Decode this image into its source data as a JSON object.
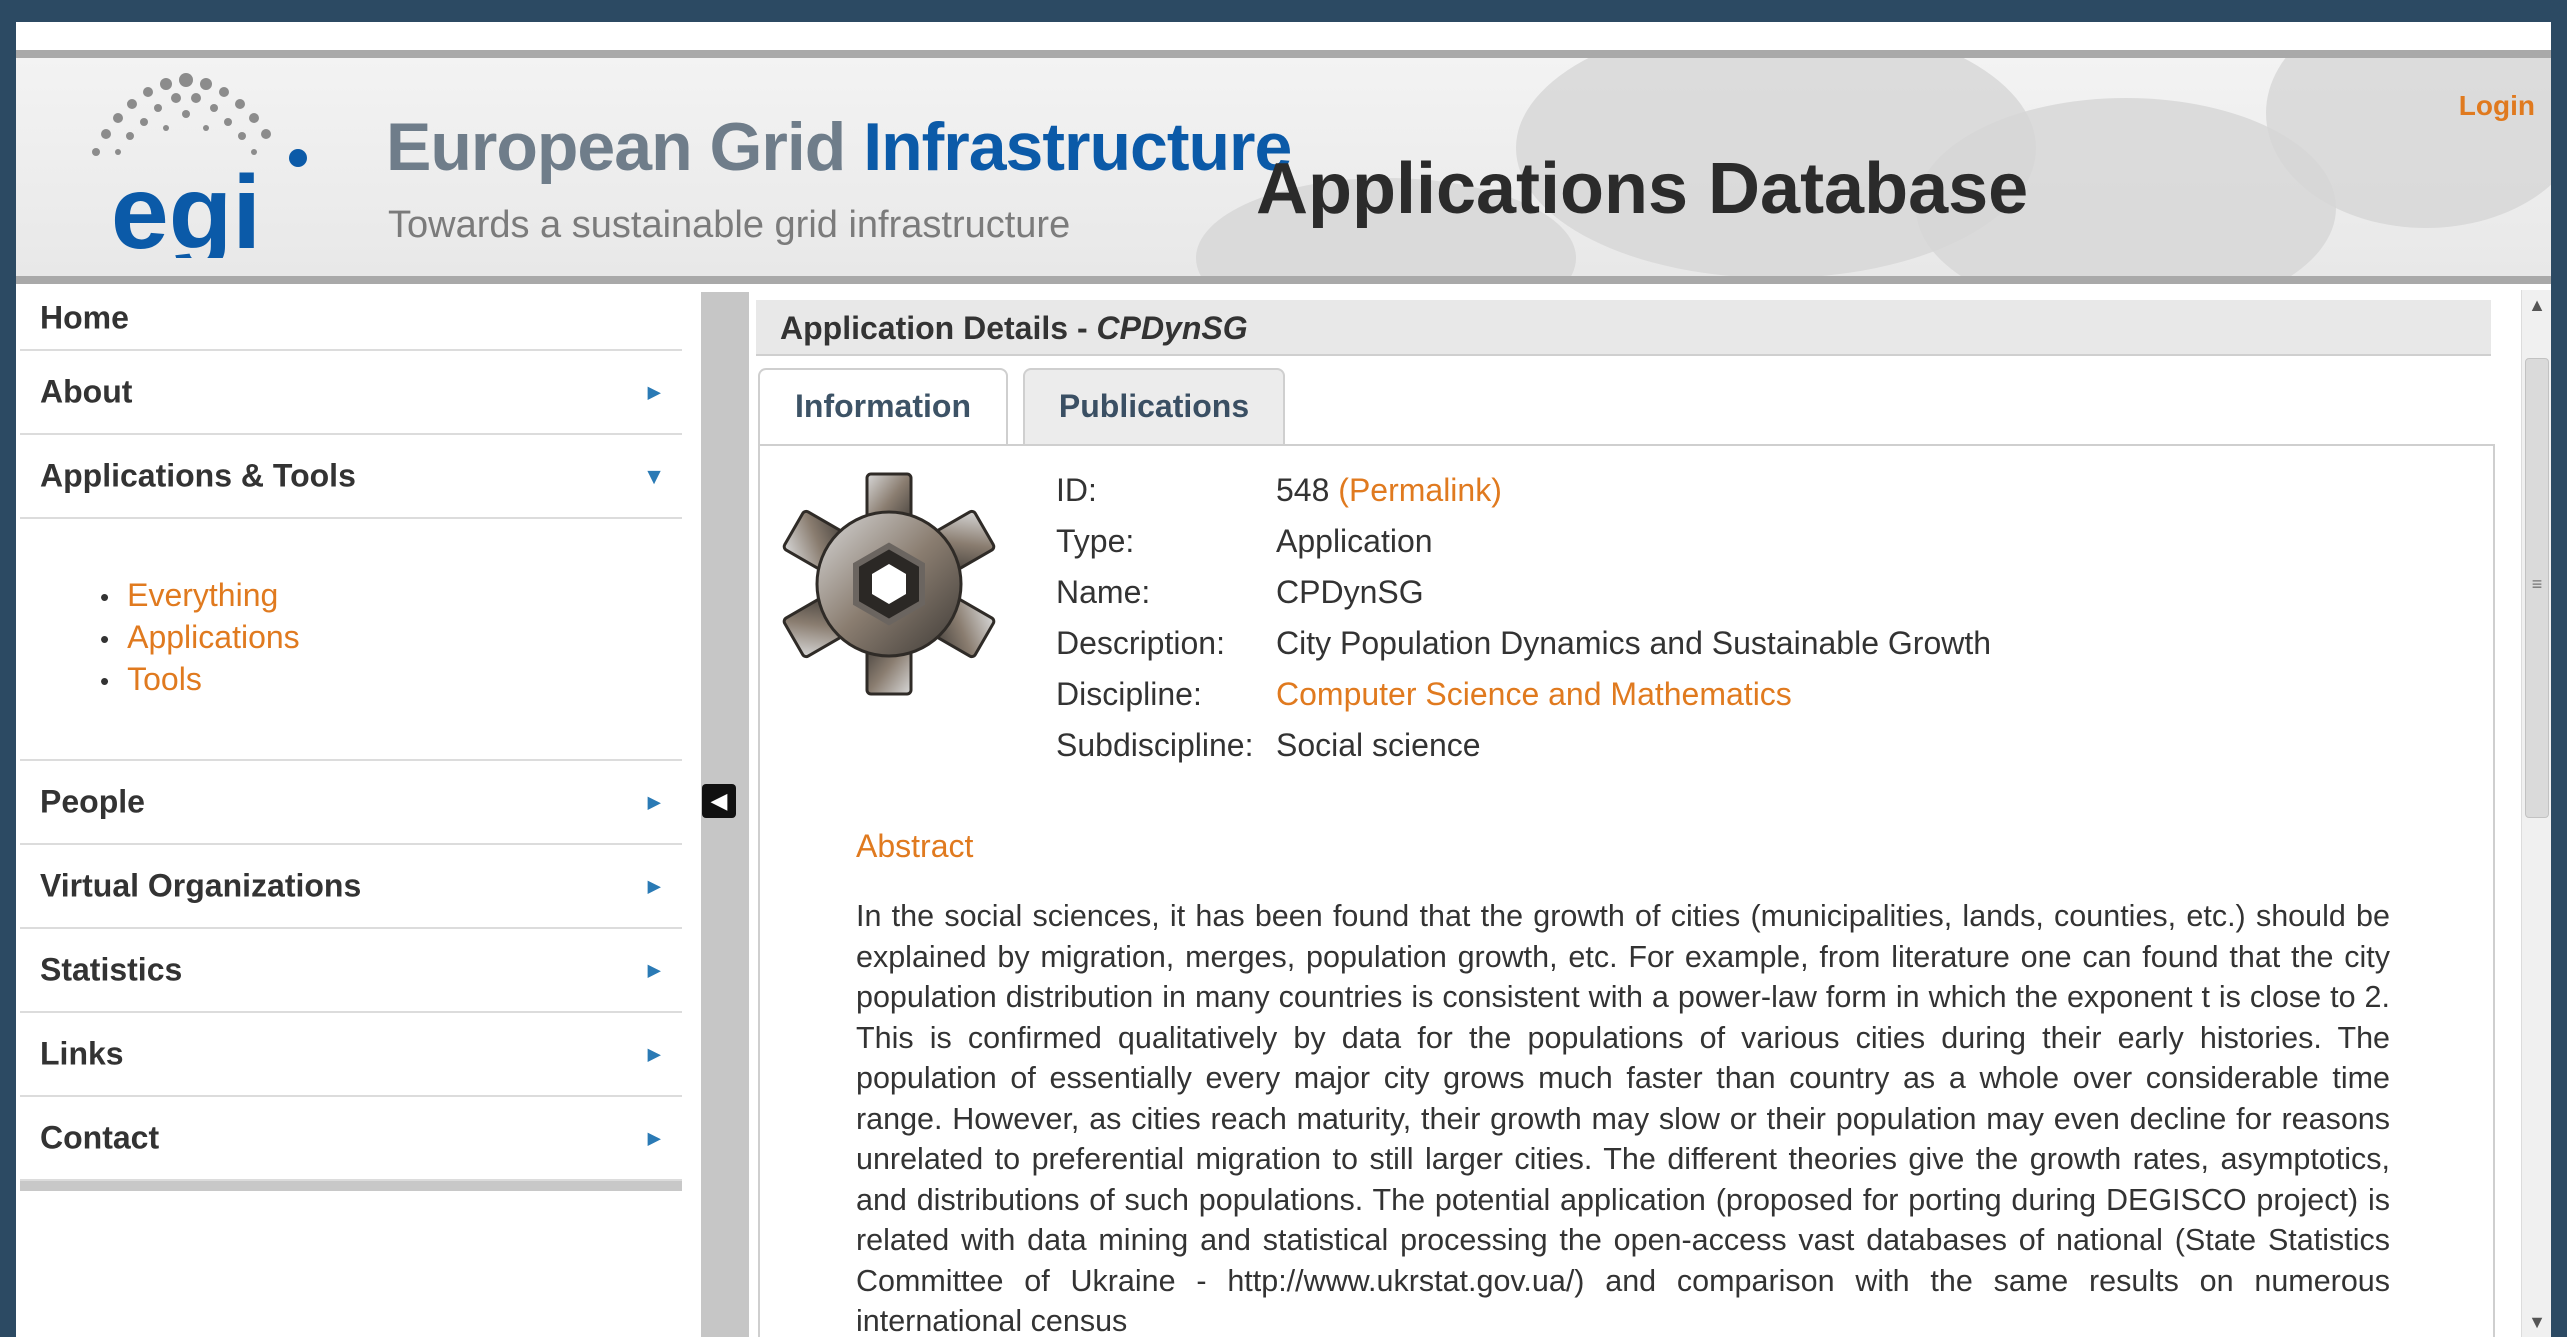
{
  "header": {
    "brand_part1": "European Grid ",
    "brand_part2": "Infrastructure",
    "tagline": "Towards a sustainable grid infrastructure",
    "app_title": "Applications Database",
    "login_label": "Login",
    "logo_text": "egi"
  },
  "sidebar": {
    "home": "Home",
    "about": "About",
    "apps_tools": "Applications & Tools",
    "sub_items": [
      "Everything",
      "Applications",
      "Tools"
    ],
    "people": "People",
    "vos": "Virtual Organizations",
    "statistics": "Statistics",
    "links": "Links",
    "contact": "Contact"
  },
  "details": {
    "title_prefix": "Application Details - ",
    "app_name": "CPDynSG"
  },
  "tabs": {
    "information": "Information",
    "publications": "Publications"
  },
  "fields": {
    "labels": [
      "ID:",
      "Type:",
      "Name:",
      "Description:",
      "Discipline:",
      "Subdiscipline:"
    ],
    "id": "548",
    "permalink": "(Permalink)",
    "type": "Application",
    "name": "CPDynSG",
    "description": "City Population Dynamics and Sustainable Growth",
    "discipline": "Computer Science and Mathematics",
    "subdiscipline": "Social science"
  },
  "abstract": {
    "title": "Abstract",
    "text": "In the social sciences, it has been found that the growth of cities (municipalities, lands, counties, etc.) should be explained by migration, merges, population growth, etc. For example, from literature one can found that the city population distribution in many countries is consistent with a power-law form in which the exponent t is close to 2. This is confirmed qualitatively by data for the populations of various cities during their early histories. The population of essentially every major city grows much faster than country as a whole over considerable time range. However, as cities reach maturity, their growth may slow or their population may even decline for reasons unrelated to preferential migration to still larger cities. The different theories give the growth rates, asymptotics, and distributions of such populations. The potential application (proposed for porting during DEGISCO project) is related with data mining and statistical processing the open-access vast databases of national (State Statistics Committee of Ukraine - http://www.ukrstat.gov.ua/) and comparison with the same results on numerous international census"
  },
  "colors": {
    "accent": "#e07a1f",
    "brand_blue": "#0b5aa8",
    "frame": "#2c4a63"
  },
  "icons": {
    "logo": "egi-logo-icon",
    "gear": "gear-icon",
    "nav_arrow": "chevron-right-icon",
    "collapse": "arrow-left-icon"
  }
}
